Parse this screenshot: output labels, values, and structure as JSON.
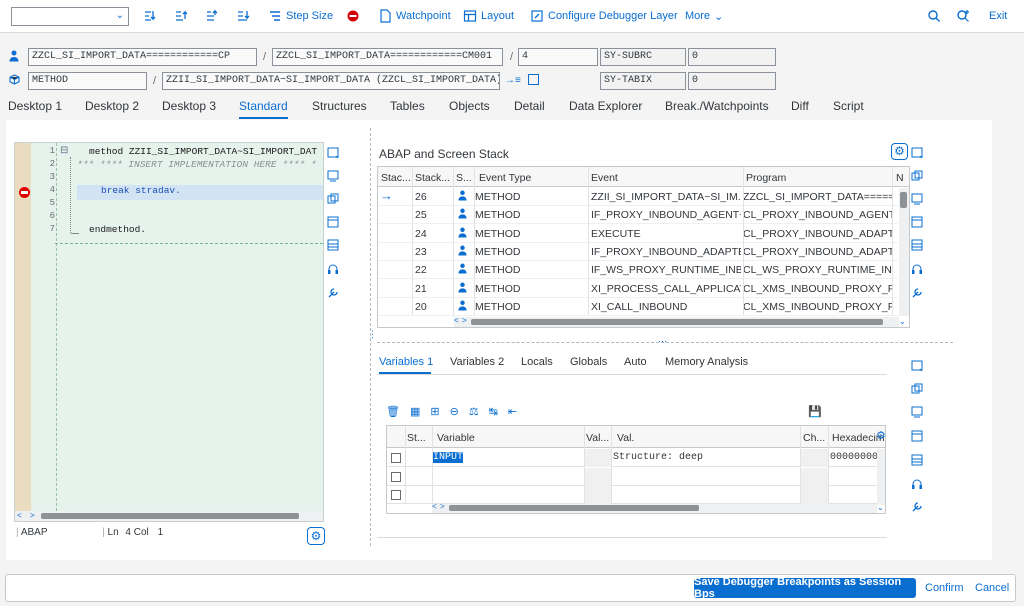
{
  "toolbar": {
    "select_value": "",
    "step_size": "Step Size",
    "watchpoint": "Watchpoint",
    "layout": "Layout",
    "configure_layer": "Configure Debugger Layer",
    "more": "More",
    "exit": "Exit"
  },
  "header": {
    "row1": {
      "program": "ZZCL_SI_IMPORT_DATA============CP",
      "include": "ZZCL_SI_IMPORT_DATA============CM001",
      "line": "4",
      "sysvar": "SY-SUBRC",
      "sysval": "0"
    },
    "row2": {
      "type": "METHOD",
      "name": "ZZII_SI_IMPORT_DATA~SI_IMPORT_DATA (ZZCL_SI_IMPORT_DATA)",
      "sysvar": "SY-TABIX",
      "sysval": "0"
    }
  },
  "tabs": [
    "Desktop 1",
    "Desktop 2",
    "Desktop 3",
    "Standard",
    "Structures",
    "Tables",
    "Objects",
    "Detail",
    "Data Explorer",
    "Break./Watchpoints",
    "Diff",
    "Script"
  ],
  "editor": {
    "lines": [
      {
        "num": "1",
        "code": "method ZZII_SI_IMPORT_DATA~SI_IMPORT_DAT"
      },
      {
        "num": "2",
        "code": "*** **** INSERT IMPLEMENTATION HERE **** *"
      },
      {
        "num": "3",
        "code": ""
      },
      {
        "num": "4",
        "code": "break stradav."
      },
      {
        "num": "5",
        "code": ""
      },
      {
        "num": "6",
        "code": ""
      },
      {
        "num": "7",
        "code": "endmethod."
      }
    ],
    "status_lang": "ABAP",
    "status_ln_label": "Ln",
    "status_ln": "4",
    "status_col_label": "Col",
    "status_col": "1"
  },
  "stack": {
    "title": "ABAP and Screen Stack",
    "columns": [
      "Stac...",
      "Stack...",
      "S...",
      "Event Type",
      "Event",
      "Program",
      "N"
    ],
    "rows": [
      {
        "level": "26",
        "type": "METHOD",
        "event": "ZZII_SI_IMPORT_DATA~SI_IM...",
        "program": "ZZCL_SI_IMPORT_DATA=====...",
        "current": true
      },
      {
        "level": "25",
        "type": "METHOD",
        "event": "IF_PROXY_INBOUND_AGENT~...",
        "program": "CL_PROXY_INBOUND_AGENT...",
        "current": false
      },
      {
        "level": "24",
        "type": "METHOD",
        "event": "EXECUTE",
        "program": "CL_PROXY_INBOUND_ADAPT...",
        "current": false
      },
      {
        "level": "23",
        "type": "METHOD",
        "event": "IF_PROXY_INBOUND_ADAPTE...",
        "program": "CL_PROXY_INBOUND_ADAPT...",
        "current": false
      },
      {
        "level": "22",
        "type": "METHOD",
        "event": "IF_WS_PROXY_RUNTIME_INB...",
        "program": "CL_WS_PROXY_RUNTIME_IN...",
        "current": false
      },
      {
        "level": "21",
        "type": "METHOD",
        "event": "XI_PROCESS_CALL_APPLICAT...",
        "program": "CL_XMS_INBOUND_PROXY_P...",
        "current": false
      },
      {
        "level": "20",
        "type": "METHOD",
        "event": "XI_CALL_INBOUND",
        "program": "CL_XMS_INBOUND_PROXY_P...",
        "current": false
      }
    ]
  },
  "vartabs": [
    "Variables 1",
    "Variables 2",
    "Locals",
    "Globals",
    "Auto",
    "Memory Analysis"
  ],
  "vars": {
    "columns": [
      "St...",
      "Variable",
      "Val...",
      "Val.",
      "Ch...",
      "Hexadecim"
    ],
    "rows": [
      {
        "variable": "INPUT",
        "value": "Structure: deep",
        "hex": "00000000"
      },
      {
        "variable": "",
        "value": "",
        "hex": ""
      },
      {
        "variable": "",
        "value": "",
        "hex": ""
      }
    ]
  },
  "footer": {
    "save_bps": "Save Debugger Breakpoints as Session Bps",
    "confirm": "Confirm",
    "cancel": "Cancel"
  },
  "colors": {
    "accent": "#0a6ed1",
    "breakpoint": "#e00000",
    "gutter": "#e9dcc0",
    "editor_bg": "#e6f2ec"
  }
}
